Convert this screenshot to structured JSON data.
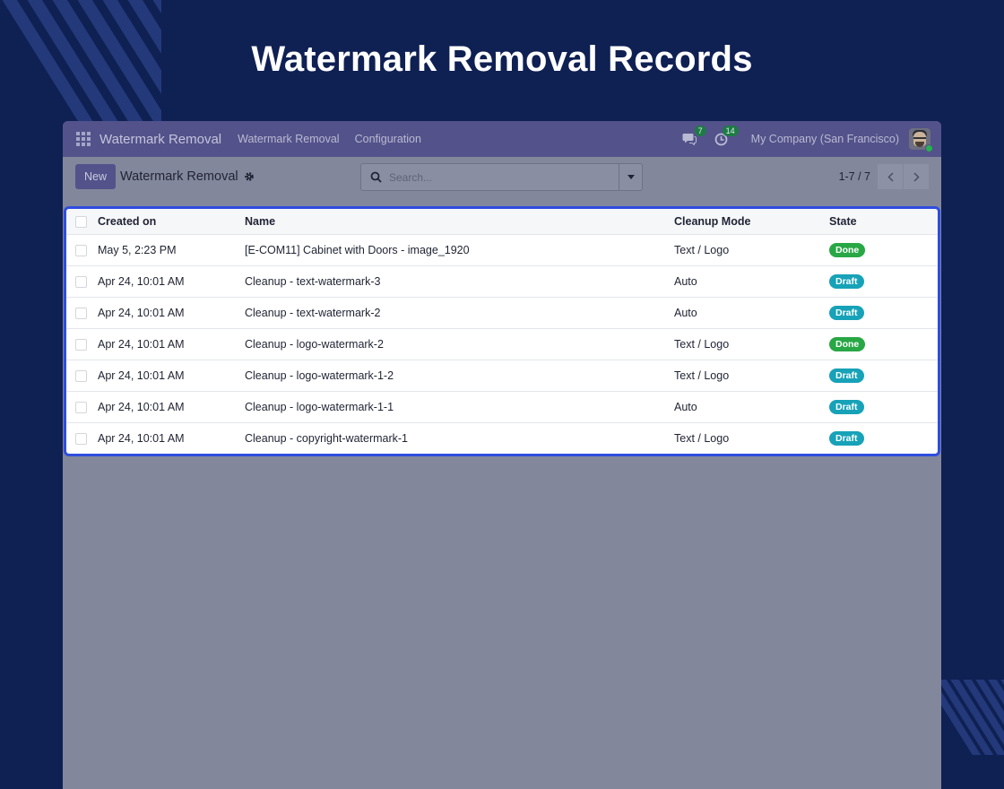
{
  "headline": "Watermark Removal Records",
  "navbar": {
    "brand": "Watermark Removal",
    "links": [
      "Watermark Removal",
      "Configuration"
    ],
    "messages_count": "7",
    "activities_count": "14",
    "company": "My Company (San Francisco)"
  },
  "control": {
    "new_label": "New",
    "breadcrumb": "Watermark Removal",
    "search_placeholder": "Search...",
    "pager": "1-7 / 7"
  },
  "table": {
    "headers": [
      "Created on",
      "Name",
      "Cleanup Mode",
      "State"
    ],
    "rows": [
      {
        "created": "May 5, 2:23 PM",
        "name": "[E-COM11] Cabinet with Doors - image_1920",
        "mode": "Text / Logo",
        "state": "Done"
      },
      {
        "created": "Apr 24, 10:01 AM",
        "name": "Cleanup - text-watermark-3",
        "mode": "Auto",
        "state": "Draft"
      },
      {
        "created": "Apr 24, 10:01 AM",
        "name": "Cleanup - text-watermark-2",
        "mode": "Auto",
        "state": "Draft"
      },
      {
        "created": "Apr 24, 10:01 AM",
        "name": "Cleanup - logo-watermark-2",
        "mode": "Text / Logo",
        "state": "Done"
      },
      {
        "created": "Apr 24, 10:01 AM",
        "name": "Cleanup - logo-watermark-1-2",
        "mode": "Text / Logo",
        "state": "Draft"
      },
      {
        "created": "Apr 24, 10:01 AM",
        "name": "Cleanup - logo-watermark-1-1",
        "mode": "Auto",
        "state": "Draft"
      },
      {
        "created": "Apr 24, 10:01 AM",
        "name": "Cleanup - copyright-watermark-1",
        "mode": "Text / Logo",
        "state": "Draft"
      }
    ]
  },
  "colors": {
    "background": "#0f2053",
    "navbar": "#53528a",
    "done": "#28a745",
    "draft": "#17a2b8",
    "highlight_border": "#2f4ddf"
  },
  "icons": [
    "apps-grid-icon",
    "chat-icon",
    "activity-clock-icon",
    "avatar",
    "gear-icon",
    "search-icon",
    "caret-down-icon",
    "chevron-left-icon",
    "chevron-right-icon"
  ]
}
